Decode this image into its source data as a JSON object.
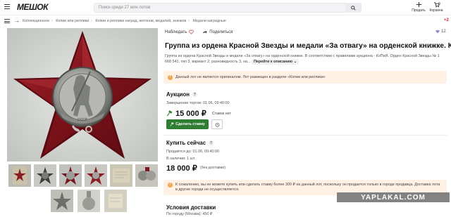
{
  "header": {
    "logo_text": "МЕШОК",
    "search_placeholder": "Поиск среди 27 млн лотов",
    "sell_label": "Продать",
    "cart_label": "Корзина",
    "cart_count": "0"
  },
  "breadcrumbs": [
    "Коллекционное",
    "Копии или реплики",
    "Копии и реплики наград, жетонов, медалей, значков",
    "Медали наградные"
  ],
  "notification_count": "+2",
  "actions": {
    "watch_label": "Наблюдать",
    "share_label": "Поделиться",
    "fav_count": "12"
  },
  "lot": {
    "title": "Группа из ордена Красной Звезды и медали «За отвагу» на орденской книжке. КоПиЯ.",
    "description": "Группа из ордена Красной Звезды и медали «За отвагу» на орденской книжке. В соответствии с правилами аукциона - КоПиЯ. Орден Красной Звезды № 1 668 541, тип 3, вариант 2, разновидность 3, на...",
    "description_link": "Перейти к описанию",
    "warning": "Данный лот не является оригиналом. Лот размещен в разделе «Копии или реплики»"
  },
  "auction": {
    "title": "Аукцион",
    "end_label": "Завершение торгов: 01.06, 09:40:00",
    "price": "15 000 ₽",
    "bid_status": "Ставок нет",
    "bid_button": "Сделать ставку"
  },
  "buy_now": {
    "title": "Купить сейчас",
    "until_label": "Продаётся до: 01.06, 09:40:00",
    "stock_label": "В наличии: 1 шт.",
    "price": "18 000 ₽",
    "price_note": "(без доставки)"
  },
  "limit_warning": "К сожалению, вы не можете купить или сделать ставку более 300 ₽ на данный лот, поскольку он продается только в городе продавца. Доставка лота в другие города не осуществляется.",
  "watermark": "YAPLAKAL.COM",
  "delivery": {
    "title": "Условия доставки",
    "line": "По городу (Москва): 450 ₽"
  },
  "colors": {
    "accent_green": "#2e7d32",
    "warning_bg": "#fff1e3",
    "brand_red": "#d8232a"
  }
}
